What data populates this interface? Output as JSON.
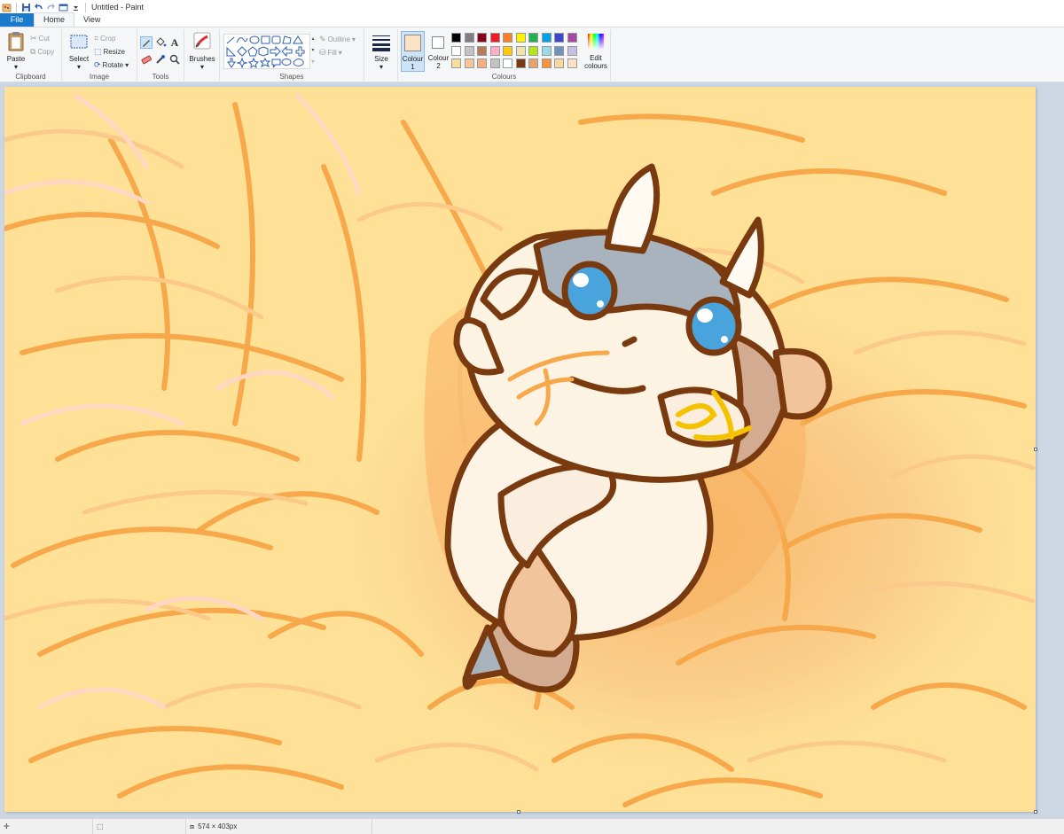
{
  "window": {
    "title": "Untitled - Paint"
  },
  "tabs": [
    {
      "label": "File"
    },
    {
      "label": "Home"
    },
    {
      "label": "View"
    }
  ],
  "ribbon": {
    "clipboard": {
      "group_label": "Clipboard",
      "paste": "Paste",
      "cut": "Cut",
      "copy": "Copy"
    },
    "image": {
      "group_label": "Image",
      "select": "Select",
      "crop": "Crop",
      "resize": "Resize",
      "rotate": "Rotate"
    },
    "tools": {
      "group_label": "Tools"
    },
    "brushes": {
      "label": "Brushes"
    },
    "shapes": {
      "group_label": "Shapes",
      "outline": "Outline",
      "fill": "Fill"
    },
    "size": {
      "label": "Size"
    },
    "colours": {
      "group_label": "Colours",
      "colour1_line1": "Colour",
      "colour1_line2": "1",
      "colour2_line1": "Colour",
      "colour2_line2": "2",
      "edit_line1": "Edit",
      "edit_line2": "colours",
      "colour1_value": "#fde3c6",
      "colour2_value": "#ffffff",
      "palette": [
        "#000000",
        "#7f7f7f",
        "#880015",
        "#ed1c24",
        "#ff7f27",
        "#fff200",
        "#22b14c",
        "#00a2e8",
        "#3f48cc",
        "#a349a4",
        "#ffffff",
        "#c3c3c3",
        "#b97a57",
        "#ffaec9",
        "#ffc90e",
        "#efe4b0",
        "#b5e61d",
        "#99d9ea",
        "#7092be",
        "#c8bfe7",
        "#f7dd9a",
        "#f6c49c",
        "#f3b07e",
        "#c3c3c3",
        "#ffffff",
        "#7a3a10",
        "#e8a46a",
        "#f5923e",
        "#f8d7a0",
        "#fde3c6"
      ]
    }
  },
  "status": {
    "dimensions": "574 × 403px"
  },
  "icons": {
    "app": "paint-icon",
    "save": "save-icon",
    "undo": "undo-icon",
    "redo": "redo-icon"
  }
}
